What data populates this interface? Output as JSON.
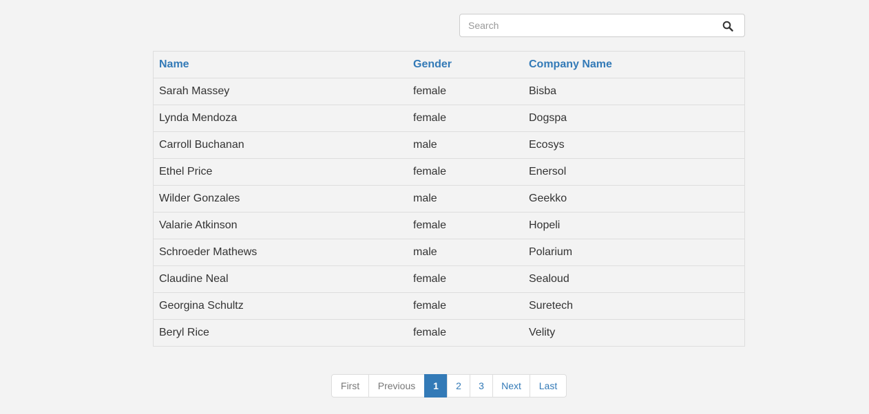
{
  "search": {
    "placeholder": "Search",
    "value": "",
    "icon": "search-icon"
  },
  "table": {
    "headers": [
      "Name",
      "Gender",
      "Company Name"
    ],
    "rows": [
      [
        "Sarah Massey",
        "female",
        "Bisba"
      ],
      [
        "Lynda Mendoza",
        "female",
        "Dogspa"
      ],
      [
        "Carroll Buchanan",
        "male",
        "Ecosys"
      ],
      [
        "Ethel Price",
        "female",
        "Enersol"
      ],
      [
        "Wilder Gonzales",
        "male",
        "Geekko"
      ],
      [
        "Valarie Atkinson",
        "female",
        "Hopeli"
      ],
      [
        "Schroeder Mathews",
        "male",
        "Polarium"
      ],
      [
        "Claudine Neal",
        "female",
        "Sealoud"
      ],
      [
        "Georgina Schultz",
        "female",
        "Suretech"
      ],
      [
        "Beryl Rice",
        "female",
        "Velity"
      ]
    ]
  },
  "pagination": {
    "first": "First",
    "previous": "Previous",
    "pages": [
      "1",
      "2",
      "3"
    ],
    "current": "1",
    "next": "Next",
    "last": "Last"
  },
  "colors": {
    "accent": "#337ab7",
    "background": "#f3f3f3",
    "border": "#dddddd"
  }
}
